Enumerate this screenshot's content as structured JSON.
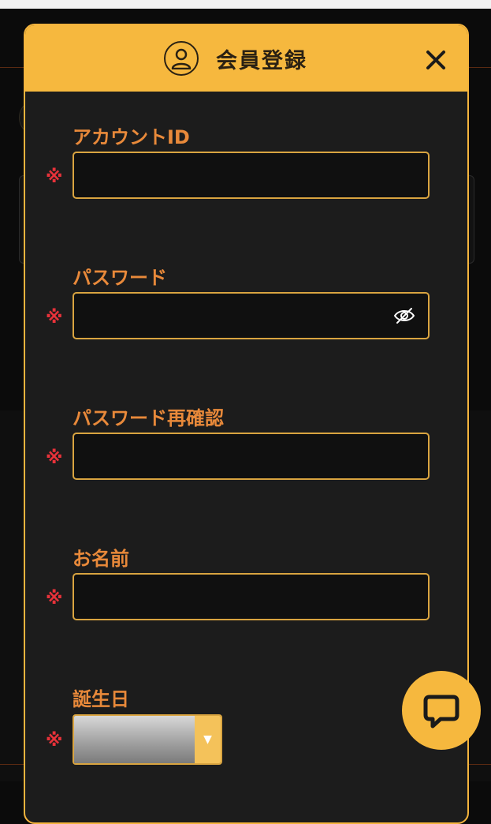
{
  "modal": {
    "title": "会員登録",
    "icons": {
      "title": "user-icon",
      "close": "close-icon"
    }
  },
  "colors": {
    "accent": "#f6b83e",
    "label": "#e8893a",
    "required": "#e8323a",
    "panel": "#1c1c1c"
  },
  "required_mark": "※",
  "fields": [
    {
      "label": "アカウントID",
      "value": "",
      "type": "text"
    },
    {
      "label": "パスワード",
      "value": "",
      "type": "password",
      "toggle_icon": "eye-slash-icon"
    },
    {
      "label": "パスワード再確認",
      "value": "",
      "type": "password"
    },
    {
      "label": "お名前",
      "value": "",
      "type": "text"
    },
    {
      "label": "誕生日",
      "selected": "",
      "type": "select"
    }
  ],
  "chat": {
    "icon": "chat-bubble-icon"
  }
}
